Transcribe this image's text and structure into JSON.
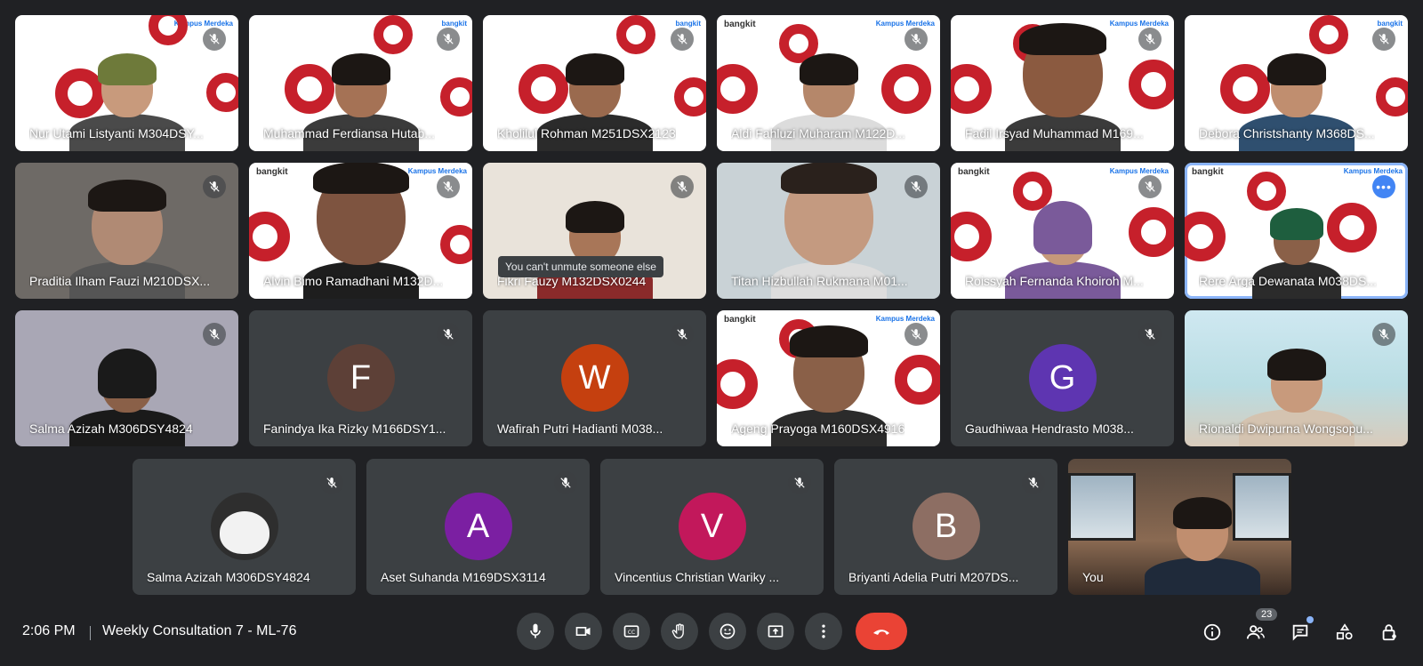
{
  "participants": [
    {
      "name": "Nur Utami Listyanti M304DSY...",
      "muted": true
    },
    {
      "name": "Muhammad Ferdiansa Hutab...",
      "muted": true
    },
    {
      "name": "Kholilul Rohman M251DSX2123",
      "muted": true
    },
    {
      "name": "Aldi Fahluzi Muharam M122D...",
      "muted": true
    },
    {
      "name": "Fadil Irsyad Muhammad M169...",
      "muted": true
    },
    {
      "name": "Debora Christshanty M368DS...",
      "muted": true
    },
    {
      "name": "Praditia Ilham Fauzi M210DSX...",
      "muted": true
    },
    {
      "name": "Alvin Bimo Ramadhani M132D...",
      "muted": true
    },
    {
      "name": "Fikri Fauzy M132DSX0244",
      "muted": true
    },
    {
      "name": "Titan Hizbullah Rukmana M01...",
      "muted": true
    },
    {
      "name": "Roissyah Fernanda Khoiroh M...",
      "muted": true
    },
    {
      "name": "Rere Arga Dewanata M038DS...",
      "muted": false,
      "speaking": true
    },
    {
      "name": "Salma Azizah M306DSY4824",
      "muted": true
    },
    {
      "name": "Fanindya Ika Rizky M166DSY1...",
      "muted": true,
      "initial": "F",
      "avatar_color": "#5d4037"
    },
    {
      "name": "Wafirah Putri Hadianti M038...",
      "muted": true,
      "initial": "W",
      "avatar_color": "#c5400f"
    },
    {
      "name": "Ageng Prayoga M160DSX4916",
      "muted": true
    },
    {
      "name": "Gaudhiwaa Hendrasto M038...",
      "muted": true,
      "initial": "G",
      "avatar_color": "#5e35b1"
    },
    {
      "name": "Rionaldi Dwipurna Wongsopu...",
      "muted": true
    },
    {
      "name": "Salma Azizah M306DSY4824",
      "muted": true
    },
    {
      "name": "Aset Suhanda M169DSX3114",
      "muted": true,
      "initial": "A",
      "avatar_color": "#7b1fa2"
    },
    {
      "name": "Vincentius Christian Wariky ...",
      "muted": true,
      "initial": "V",
      "avatar_color": "#c2185b"
    },
    {
      "name": "Briyanti Adelia Putri M207DS...",
      "muted": true,
      "initial": "B",
      "avatar_color": "#8d6e63"
    },
    {
      "name": "You",
      "muted": false
    }
  ],
  "logos": {
    "bangkit": "bangkit",
    "kampus": "Kampus Merdeka"
  },
  "tooltip": "You can't unmute someone else",
  "bottom_bar": {
    "time": "2:06 PM",
    "meeting_name": "Weekly Consultation 7 - ML-76",
    "people_count": "23"
  },
  "colors": {
    "background": "#202124",
    "end_call": "#ea4335",
    "accent": "#8ab4f8"
  }
}
